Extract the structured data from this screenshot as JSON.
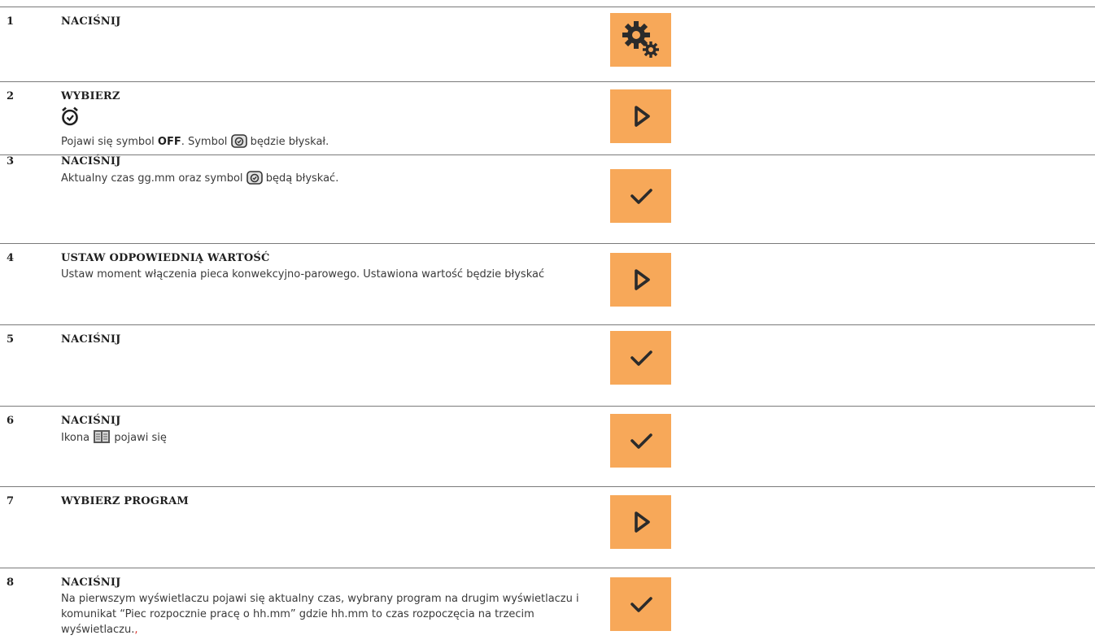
{
  "steps": [
    {
      "num": "1",
      "action": "NACIŚNIJ",
      "button": "settings-gears"
    },
    {
      "num": "2",
      "action": "WYBIERZ",
      "text_a": "Pojawi się symbol ",
      "text_bold": "OFF",
      "text_b": ". Symbol ",
      "text_c": " będzie błyskał.",
      "button": "arrow-right"
    },
    {
      "num": "3",
      "action": "NACIŚNIJ",
      "text_a": "Aktualny czas gg.mm oraz symbol ",
      "text_b": " będą błyskać.",
      "button": "checkmark"
    },
    {
      "num": "4",
      "action": "USTAW ODPOWIEDNIĄ WARTOŚĆ",
      "text": "Ustaw moment włączenia pieca konwekcyjno-parowego. Ustawiona wartość będzie błyskać",
      "button": "arrow-right"
    },
    {
      "num": "5",
      "action": "NACIŚNIJ",
      "button": "checkmark"
    },
    {
      "num": "6",
      "action": "NACIŚNIJ",
      "text_a": "Ikona ",
      "text_b": " pojawi się",
      "button": "checkmark"
    },
    {
      "num": "7",
      "action": "WYBIERZ PROGRAM",
      "button": "arrow-right"
    },
    {
      "num": "8",
      "action": "NACIŚNIJ",
      "text": "Na pierwszym wyświetlaczu pojawi się aktualny czas, wybrany program na drugim wyświetlaczu i komunikat “Piec rozpocznie pracę o hh.mm” gdzie hh.mm to czas rozpoczęcia na trzecim wyświetlaczu.",
      "text_tail": ",",
      "button": "checkmark"
    }
  ],
  "colors": {
    "button_bg": "#f7a859",
    "icon": "#2b2b2b",
    "divider": "#7a7a7a",
    "tail": "#d9342b"
  }
}
